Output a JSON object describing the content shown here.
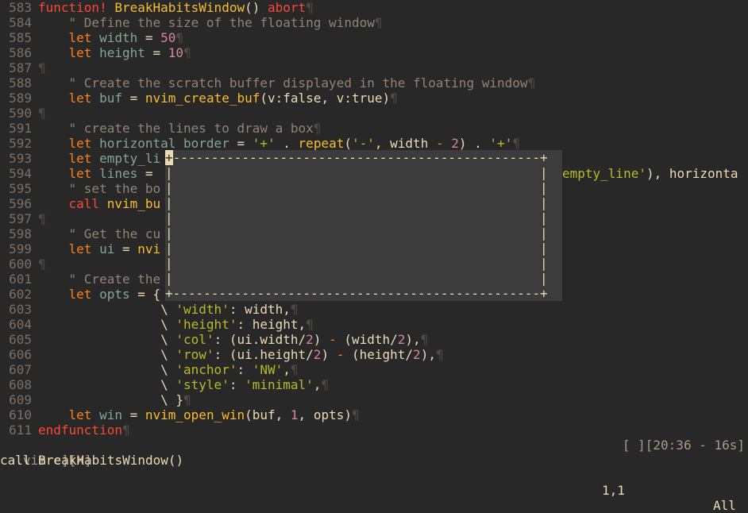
{
  "editor": {
    "lines": [
      {
        "n": "583",
        "code": [
          [
            "c-kw",
            "function! "
          ],
          [
            "c-fn",
            "BreakHabitsWindow"
          ],
          [
            "c-txt",
            "() "
          ],
          [
            "c-kw",
            "abort"
          ],
          [
            "c-eol",
            "¶"
          ]
        ]
      },
      {
        "n": "584",
        "code": [
          [
            "c-com",
            "    \" Define the size of the floating window"
          ],
          [
            "c-eol",
            "¶"
          ]
        ]
      },
      {
        "n": "585",
        "code": [
          [
            "c-let",
            "    let "
          ],
          [
            "c-var",
            "width"
          ],
          [
            "c-txt",
            " = "
          ],
          [
            "c-num",
            "50"
          ],
          [
            "c-eol",
            "¶"
          ]
        ]
      },
      {
        "n": "586",
        "code": [
          [
            "c-let",
            "    let "
          ],
          [
            "c-var",
            "height"
          ],
          [
            "c-txt",
            " = "
          ],
          [
            "c-num",
            "10"
          ],
          [
            "c-eol",
            "¶"
          ]
        ]
      },
      {
        "n": "587",
        "code": [
          [
            "c-eol",
            "¶"
          ]
        ]
      },
      {
        "n": "588",
        "code": [
          [
            "c-com",
            "    \" Create the scratch buffer displayed in the floating window"
          ],
          [
            "c-eol",
            "¶"
          ]
        ]
      },
      {
        "n": "589",
        "code": [
          [
            "c-let",
            "    let "
          ],
          [
            "c-var",
            "buf"
          ],
          [
            "c-txt",
            " = "
          ],
          [
            "c-fn",
            "nvim_create_buf"
          ],
          [
            "c-txt",
            "(v:false, v:true)"
          ],
          [
            "c-eol",
            "¶"
          ]
        ]
      },
      {
        "n": "590",
        "code": [
          [
            "c-eol",
            "¶"
          ]
        ]
      },
      {
        "n": "591",
        "code": [
          [
            "c-com",
            "    \" create the lines to draw a box"
          ],
          [
            "c-eol",
            "¶"
          ]
        ]
      },
      {
        "n": "592",
        "code": [
          [
            "c-let",
            "    let "
          ],
          [
            "c-var",
            "horizontal_border"
          ],
          [
            "c-txt",
            " = "
          ],
          [
            "c-str",
            "'+'"
          ],
          [
            "c-txt",
            " . "
          ],
          [
            "c-fn",
            "repeat"
          ],
          [
            "c-txt",
            "("
          ],
          [
            "c-str",
            "'-'"
          ],
          [
            "c-txt",
            ", width "
          ],
          [
            "c-op",
            "-"
          ],
          [
            "c-txt",
            " "
          ],
          [
            "c-num",
            "2"
          ],
          [
            "c-txt",
            ") . "
          ],
          [
            "c-str",
            "'+'"
          ],
          [
            "c-eol",
            "¶"
          ]
        ]
      },
      {
        "n": "593",
        "code": [
          [
            "c-let",
            "    let "
          ],
          [
            "c-var",
            "empty_li"
          ]
        ]
      },
      {
        "n": "594",
        "code": [
          [
            "c-let",
            "    let "
          ],
          [
            "c-var",
            "lines"
          ],
          [
            "c-txt",
            " = "
          ]
        ]
      },
      {
        "n": "595",
        "code": [
          [
            "c-com",
            "    \" set the bo"
          ]
        ]
      },
      {
        "n": "596",
        "code": [
          [
            "c-kw",
            "    call "
          ],
          [
            "c-fn",
            "nvim_bu"
          ]
        ]
      },
      {
        "n": "597",
        "code": [
          [
            "c-eol",
            "¶"
          ]
        ]
      },
      {
        "n": "598",
        "code": [
          [
            "c-com",
            "    \" Get the cu"
          ]
        ]
      },
      {
        "n": "599",
        "code": [
          [
            "c-let",
            "    let "
          ],
          [
            "c-var",
            "ui"
          ],
          [
            "c-txt",
            " = "
          ],
          [
            "c-fn",
            "nvi"
          ]
        ]
      },
      {
        "n": "600",
        "code": [
          [
            "c-eol",
            "¶"
          ]
        ]
      },
      {
        "n": "601",
        "code": [
          [
            "c-com",
            "    \" Create the"
          ]
        ]
      },
      {
        "n": "602",
        "code": [
          [
            "c-let",
            "    let "
          ],
          [
            "c-var",
            "opts"
          ],
          [
            "c-txt",
            " = {"
          ]
        ]
      },
      {
        "n": "603",
        "code": [
          [
            "c-txt",
            "                \\ "
          ],
          [
            "c-str",
            "'width'"
          ],
          [
            "c-txt",
            ": width,"
          ],
          [
            "c-eol",
            "¶"
          ]
        ]
      },
      {
        "n": "604",
        "code": [
          [
            "c-txt",
            "                \\ "
          ],
          [
            "c-str",
            "'height'"
          ],
          [
            "c-txt",
            ": height,"
          ],
          [
            "c-eol",
            "¶"
          ]
        ]
      },
      {
        "n": "605",
        "code": [
          [
            "c-txt",
            "                \\ "
          ],
          [
            "c-str",
            "'col'"
          ],
          [
            "c-txt",
            ": (ui.width/"
          ],
          [
            "c-num",
            "2"
          ],
          [
            "c-txt",
            ") "
          ],
          [
            "c-op",
            "-"
          ],
          [
            "c-txt",
            " (width/"
          ],
          [
            "c-num",
            "2"
          ],
          [
            "c-txt",
            "),"
          ],
          [
            "c-eol",
            "¶"
          ]
        ]
      },
      {
        "n": "606",
        "code": [
          [
            "c-txt",
            "                \\ "
          ],
          [
            "c-str",
            "'row'"
          ],
          [
            "c-txt",
            ": (ui.height/"
          ],
          [
            "c-num",
            "2"
          ],
          [
            "c-txt",
            ") "
          ],
          [
            "c-op",
            "-"
          ],
          [
            "c-txt",
            " (height/"
          ],
          [
            "c-num",
            "2"
          ],
          [
            "c-txt",
            "),"
          ],
          [
            "c-eol",
            "¶"
          ]
        ]
      },
      {
        "n": "607",
        "code": [
          [
            "c-txt",
            "                \\ "
          ],
          [
            "c-str",
            "'anchor'"
          ],
          [
            "c-txt",
            ": "
          ],
          [
            "c-str",
            "'NW'"
          ],
          [
            "c-txt",
            ","
          ],
          [
            "c-eol",
            "¶"
          ]
        ]
      },
      {
        "n": "608",
        "code": [
          [
            "c-txt",
            "                \\ "
          ],
          [
            "c-str",
            "'style'"
          ],
          [
            "c-txt",
            ": "
          ],
          [
            "c-str",
            "'minimal'"
          ],
          [
            "c-txt",
            ","
          ],
          [
            "c-eol",
            "¶"
          ]
        ]
      },
      {
        "n": "609",
        "code": [
          [
            "c-txt",
            "                \\ }"
          ],
          [
            "c-eol",
            "¶"
          ]
        ]
      },
      {
        "n": "610",
        "code": [
          [
            "c-let",
            "    let "
          ],
          [
            "c-var",
            "win"
          ],
          [
            "c-txt",
            " = "
          ],
          [
            "c-fn",
            "nvim_open_win"
          ],
          [
            "c-txt",
            "(buf, "
          ],
          [
            "c-num",
            "1"
          ],
          [
            "c-txt",
            ", opts)"
          ],
          [
            "c-eol",
            "¶"
          ]
        ]
      },
      {
        "n": "611",
        "code": [
          [
            "c-kw",
            "endfunction"
          ],
          [
            "c-eol",
            "¶"
          ]
        ]
      }
    ],
    "line594_tail": "empty_line'), horizonta"
  },
  "floating_window": {
    "top_border": "+------------------------------------------------+",
    "middle_row": "|                                                |",
    "bottom_border": "+------------------------------------------------+"
  },
  "statusline": {
    "left": ".vimrc][X]",
    "right": "[ ][20:36 - 16s]"
  },
  "cmdline": "call BreakHabitsWindow()",
  "ruler": {
    "position": "1,1",
    "scroll": "All"
  },
  "colors": {
    "background": "#282828",
    "float_bg": "#3c3c3c",
    "keyword": "#fb4934",
    "function": "#fabd2f",
    "string": "#b8bb26",
    "number": "#d3869b",
    "comment": "#928374"
  }
}
